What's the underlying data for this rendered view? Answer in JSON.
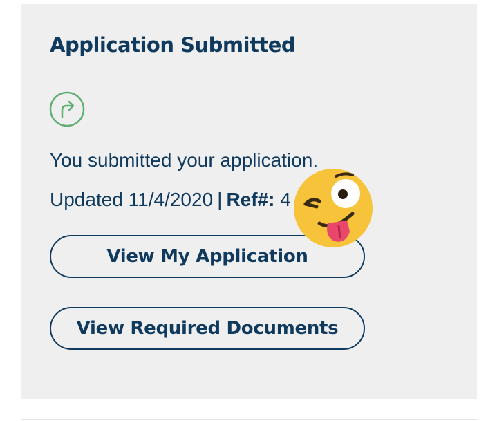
{
  "card": {
    "title": "Application Submitted",
    "status_icon": "share-arrow-icon",
    "message": "You submitted your application.",
    "updated_prefix": "Updated",
    "updated_date": "11/4/2020",
    "separator": "|",
    "ref_label": "Ref#:",
    "ref_value": "4",
    "buttons": {
      "view_application": "View My Application",
      "view_documents": "View Required Documents"
    }
  },
  "overlay": {
    "emoji": "zany-face-emoji"
  },
  "colors": {
    "text": "#0f3a5e",
    "card_background": "#efefef",
    "icon_green": "#5fae73",
    "emoji_yellow": "#f6c33b"
  }
}
